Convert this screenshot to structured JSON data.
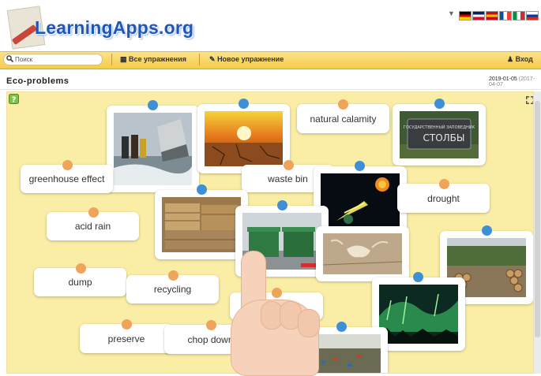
{
  "app": {
    "logo_text": "LearningApps.org"
  },
  "languages": [
    {
      "name": "de-flag-icon",
      "colors": [
        "#000000",
        "#dd0000",
        "#ffce00"
      ]
    },
    {
      "name": "gb-flag-icon",
      "colors": [
        "#012169",
        "#ffffff",
        "#c8102e"
      ]
    },
    {
      "name": "es-flag-icon",
      "colors": [
        "#c60b1e",
        "#ffc400",
        "#c60b1e"
      ]
    },
    {
      "name": "fr-flag-icon",
      "colors": [
        "#0055a4",
        "#ffffff",
        "#ef4135"
      ]
    },
    {
      "name": "it-flag-icon",
      "colors": [
        "#009246",
        "#ffffff",
        "#ce2b37"
      ]
    },
    {
      "name": "ru-flag-icon",
      "colors": [
        "#ffffff",
        "#0039a6",
        "#d52b1e"
      ]
    }
  ],
  "toolbar": {
    "search_placeholder": "Поиск",
    "all_exercises": "Все упражнения",
    "new_exercise": "Новое упражнение",
    "login": "Вход"
  },
  "page": {
    "title": "Eco-problems",
    "date": "2019-01-05",
    "date_extra": "(2017-04-07"
  },
  "labels": {
    "greenhouse": "greenhouse effect",
    "natural": "natural calamity",
    "waste": "waste bin",
    "drought": "drought",
    "acid": "acid rain",
    "dump": "dump",
    "recycling": "recycling",
    "preserve": "preserve",
    "chop": "chop down"
  },
  "images": {
    "stone_text": "ГОСУДАРСТВЕННЫЙ ЗАПОВЕДНИК",
    "stone_big": "СТОЛБЫ"
  },
  "colors": {
    "accent": "#f6cb4a",
    "canvas": "#faeda5",
    "pin_orange": "#f0a35a",
    "pin_blue": "#3f8fd6"
  }
}
